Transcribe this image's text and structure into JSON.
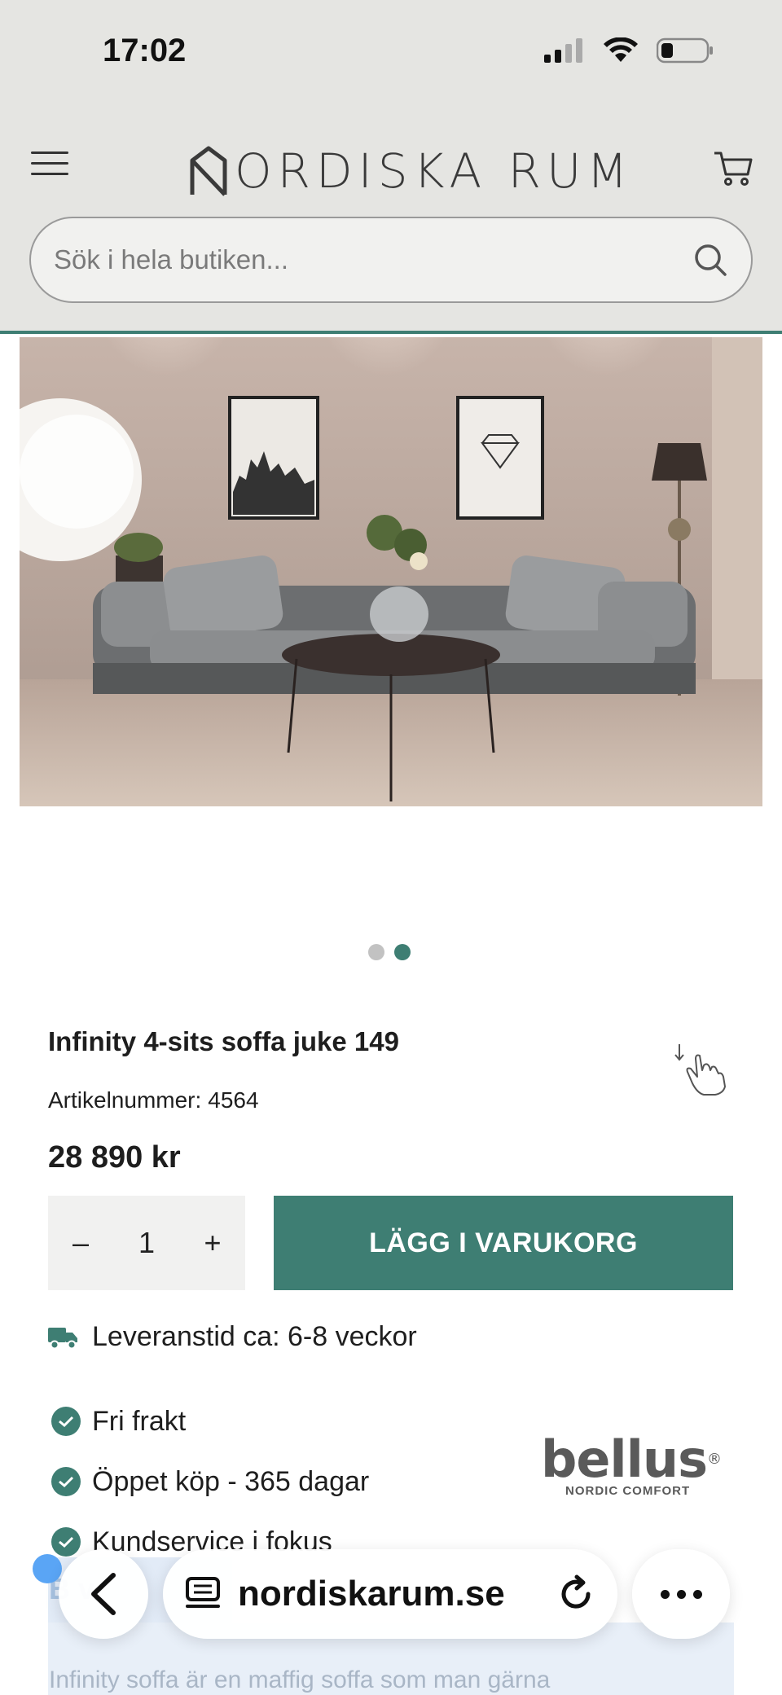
{
  "status_bar": {
    "time": "17:02"
  },
  "header": {
    "logo_text": "ORDISKA RUM",
    "search_placeholder": "Sök i hela butiken..."
  },
  "hero": {
    "image_alt": "Grå soffa i vardagsrum med tavlor"
  },
  "carousel": {
    "total_slides": 2,
    "active_slide": 2
  },
  "product": {
    "title": "Infinity 4-sits soffa juke 149",
    "sku_label": "Artikelnummer:",
    "sku_value": "4564",
    "price": "28 890 kr",
    "quantity": "1",
    "qty_minus": "–",
    "qty_plus": "+",
    "add_to_cart": "LÄGG I VARUKORG",
    "delivery": "Leveranstid ca: 6-8 veckor",
    "benefits": [
      "Fri frakt",
      "Öppet köp - 365 dagar",
      "Kundservice i fokus"
    ]
  },
  "brand": {
    "name": "bellus",
    "tagline": "NORDIC COMFORT"
  },
  "description": {
    "tab_label": "B         v",
    "text": "Infinity soffa är en maffig soffa som man gärna"
  },
  "browser": {
    "url": "nordiskarum.se"
  },
  "colors": {
    "accent": "#3e7e73",
    "header_bg": "#e5e5e2"
  }
}
